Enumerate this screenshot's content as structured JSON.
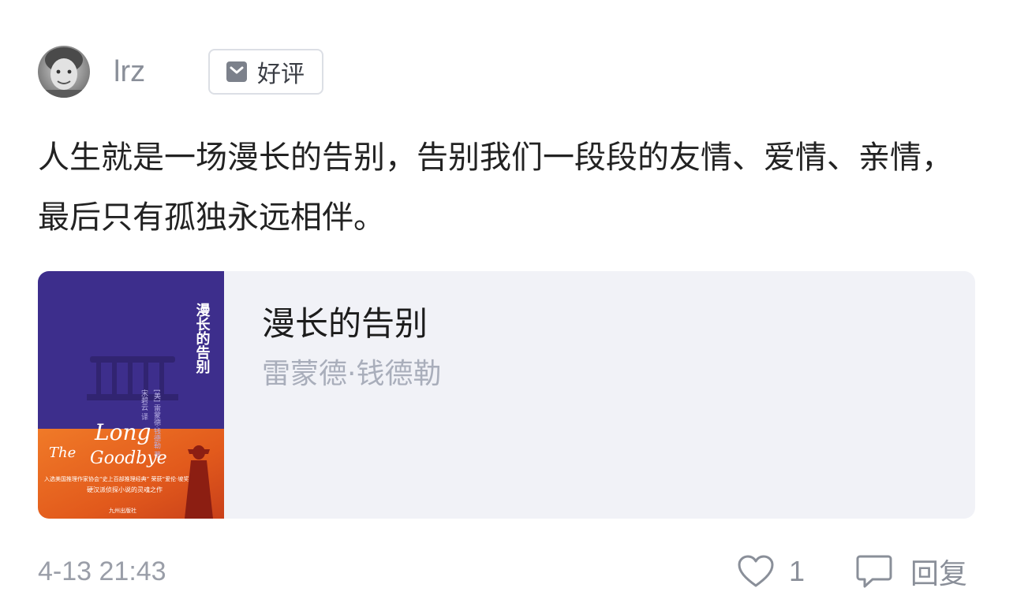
{
  "user": {
    "name": "lrz"
  },
  "badge": {
    "label": "好评",
    "icon": "bookmark-check-icon"
  },
  "review": {
    "text": "人生就是一场漫长的告别，告别我们一段段的友情、爱情、亲情，最后只有孤独永远相伴。"
  },
  "book": {
    "title": "漫长的告别",
    "author": "雷蒙德·钱德勒",
    "cover": {
      "title_vertical": "漫长的告别",
      "en_title_1": "The",
      "en_title_2": "Long",
      "en_title_3": "Goodbye",
      "blurb_1": "入选美国推理作家协会“史上百部推理经典” 荣获“爱伦·坡奖”殊荣",
      "blurb_2": "硬汉派侦探小说的灵魂之作",
      "top_color": "#3d2e8c",
      "bottom_color": "#e8651f"
    }
  },
  "footer": {
    "timestamp": "4-13 21:43",
    "like_count": "1",
    "reply_label": "回复"
  }
}
